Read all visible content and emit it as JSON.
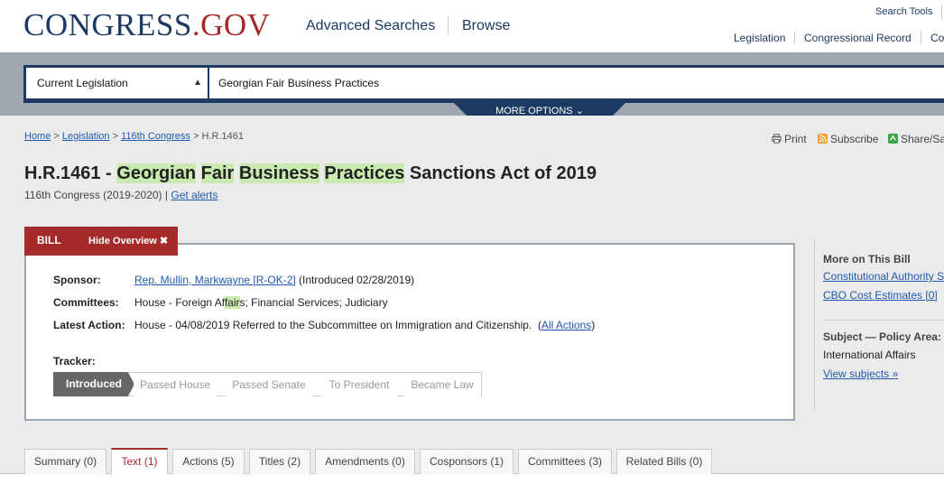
{
  "header": {
    "logo_main": "CONGRESS",
    "logo_dot": ".",
    "logo_gov": "GOV",
    "nav_advanced": "Advanced Searches",
    "nav_browse": "Browse",
    "search_tools": "Search Tools",
    "subnav": [
      "Legislation",
      "Congressional Record",
      "Co"
    ]
  },
  "search": {
    "scope": "Current Legislation",
    "query": "Georgian Fair Business Practices",
    "more_options": "MORE OPTIONS"
  },
  "breadcrumb": {
    "home": "Home",
    "sep": ">",
    "legislation": "Legislation",
    "congress": "116th Congress",
    "current": "H.R.1461"
  },
  "toolbar": {
    "print": "Print",
    "subscribe": "Subscribe",
    "share": "Share/Sa"
  },
  "bill": {
    "number_prefix": "H.R.1461 - ",
    "title_words": [
      "Georgian",
      "Fair",
      "Business",
      "Practices"
    ],
    "title_rest": "Sanctions Act of 2019",
    "congress": "116th Congress (2019-2020)",
    "sep": "|",
    "get_alerts": "Get alerts"
  },
  "overview": {
    "tab_label": "BILL",
    "hide_label": "Hide Overview ✖",
    "sponsor_label": "Sponsor:",
    "sponsor_name": "Rep. Mullin, Markwayne [R-OK-2]",
    "sponsor_intro": " (Introduced 02/28/2019)",
    "committees_label": "Committees:",
    "committees_pre": "House - Foreign Af",
    "committees_hl": "fair",
    "committees_post": "s; Financial Services; Judiciary",
    "latest_label": "Latest Action:",
    "latest_text": "House - 04/08/2019 Referred to the Subcommittee on Immigration and Citizenship.  (",
    "all_actions": "All Actions",
    "latest_close": ")",
    "tracker_label": "Tracker:",
    "tracker_steps": [
      "Introduced",
      "Passed House",
      "Passed Senate",
      "To President",
      "Became Law"
    ]
  },
  "sidebar": {
    "more_title": "More on This Bill",
    "link_authority": "Constitutional Authority S",
    "link_cbo": "CBO Cost Estimates [0]",
    "subject_title": "Subject — Policy Area:",
    "policy_area": "International Affairs",
    "view_subjects": "View subjects »"
  },
  "tabs": [
    "Summary (0)",
    "Text (1)",
    "Actions (5)",
    "Titles (2)",
    "Amendments (0)",
    "Cosponsors (1)",
    "Committees (3)",
    "Related Bills (0)"
  ],
  "colors": {
    "navy": "#1d3a63",
    "maroon": "#a52a2a",
    "highlight": "#c9ebb0",
    "link": "#1f5ab0"
  }
}
